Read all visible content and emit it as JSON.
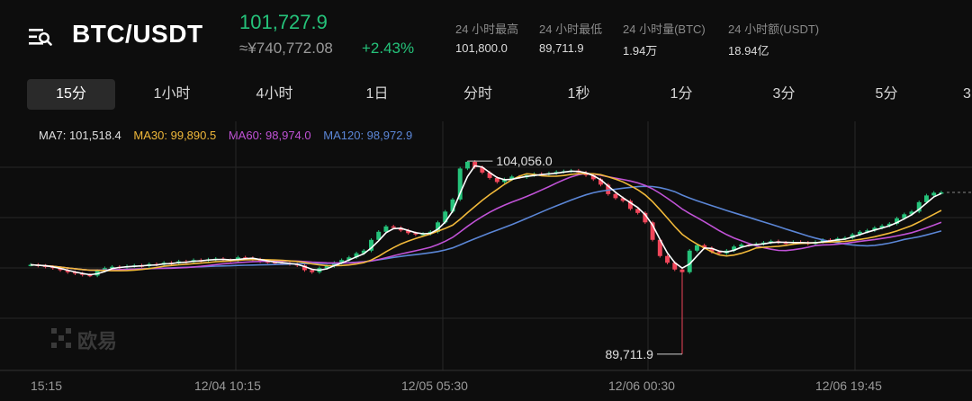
{
  "header": {
    "menu_icon": "list-search-icon",
    "pair": "BTC/USDT",
    "price": "101,727.9",
    "cny_price": "≈¥740,772.08",
    "change": "+2.43%",
    "stats": [
      {
        "label": "24 小时最高",
        "value": "101,800.0"
      },
      {
        "label": "24 小时最低",
        "value": "89,711.9"
      },
      {
        "label": "24 小时量(BTC)",
        "value": "1.94万"
      },
      {
        "label": "24 小时额(USDT)",
        "value": "18.94亿"
      }
    ]
  },
  "tabs": [
    "15分",
    "1小时",
    "4小时",
    "1日",
    "分时",
    "1秒",
    "1分",
    "3分",
    "5分",
    "3"
  ],
  "active_tab": "15分",
  "indicators": {
    "ma7": "MA7: 101,518.4",
    "ma30": "MA30: 99,890.5",
    "ma60": "MA60: 98,974.0",
    "ma120": "MA120: 98,972.9"
  },
  "colors": {
    "up": "#25c27a",
    "down": "#f0465a",
    "ma7": "#ffffff",
    "ma30": "#f0b83a",
    "ma60": "#c052d6",
    "ma120": "#5b86d6"
  },
  "annotations": {
    "high": "104,056.0",
    "low": "89,711.9"
  },
  "watermark": "欧易",
  "chart_data": {
    "type": "candlestick",
    "x_tick_labels": [
      "15:15",
      "12/04 10:15",
      "12/05 05:30",
      "12/06 00:30",
      "12/06 19:45"
    ],
    "y_range": [
      88500,
      106000
    ],
    "high_marker": 104056.0,
    "low_marker": 89711.9,
    "last_price": 101727.9,
    "close_series": [
      96350,
      96280,
      96200,
      96100,
      95950,
      95800,
      95700,
      95600,
      95550,
      95900,
      96100,
      96200,
      96150,
      96250,
      96300,
      96250,
      96400,
      96350,
      96500,
      96450,
      96600,
      96550,
      96700,
      96650,
      96750,
      96800,
      96700,
      96650,
      96900,
      96850,
      96750,
      96600,
      96550,
      96500,
      96450,
      96400,
      96300,
      95950,
      95800,
      96100,
      96250,
      96500,
      96700,
      96900,
      97200,
      97400,
      98200,
      98800,
      99200,
      99100,
      98900,
      98700,
      98600,
      98650,
      98800,
      99500,
      100300,
      101200,
      103500,
      104000,
      103600,
      103200,
      102800,
      102500,
      102700,
      102900,
      102850,
      103000,
      103100,
      103050,
      103150,
      103250,
      103300,
      103350,
      103200,
      103000,
      102700,
      102300,
      101600,
      101300,
      101100,
      100500,
      100200,
      99500,
      98200,
      97000,
      96500,
      96000,
      95800,
      97400,
      97800,
      97600,
      97300,
      97200,
      97400,
      97700,
      97850,
      97800,
      97900,
      98000,
      98100,
      98000,
      97950,
      98050,
      98000,
      97900,
      98050,
      98200,
      98100,
      98300,
      98350,
      98600,
      98800,
      98900,
      99100,
      99250,
      99400,
      99800,
      100100,
      100300,
      101000,
      101500,
      101700,
      101727.9
    ]
  }
}
